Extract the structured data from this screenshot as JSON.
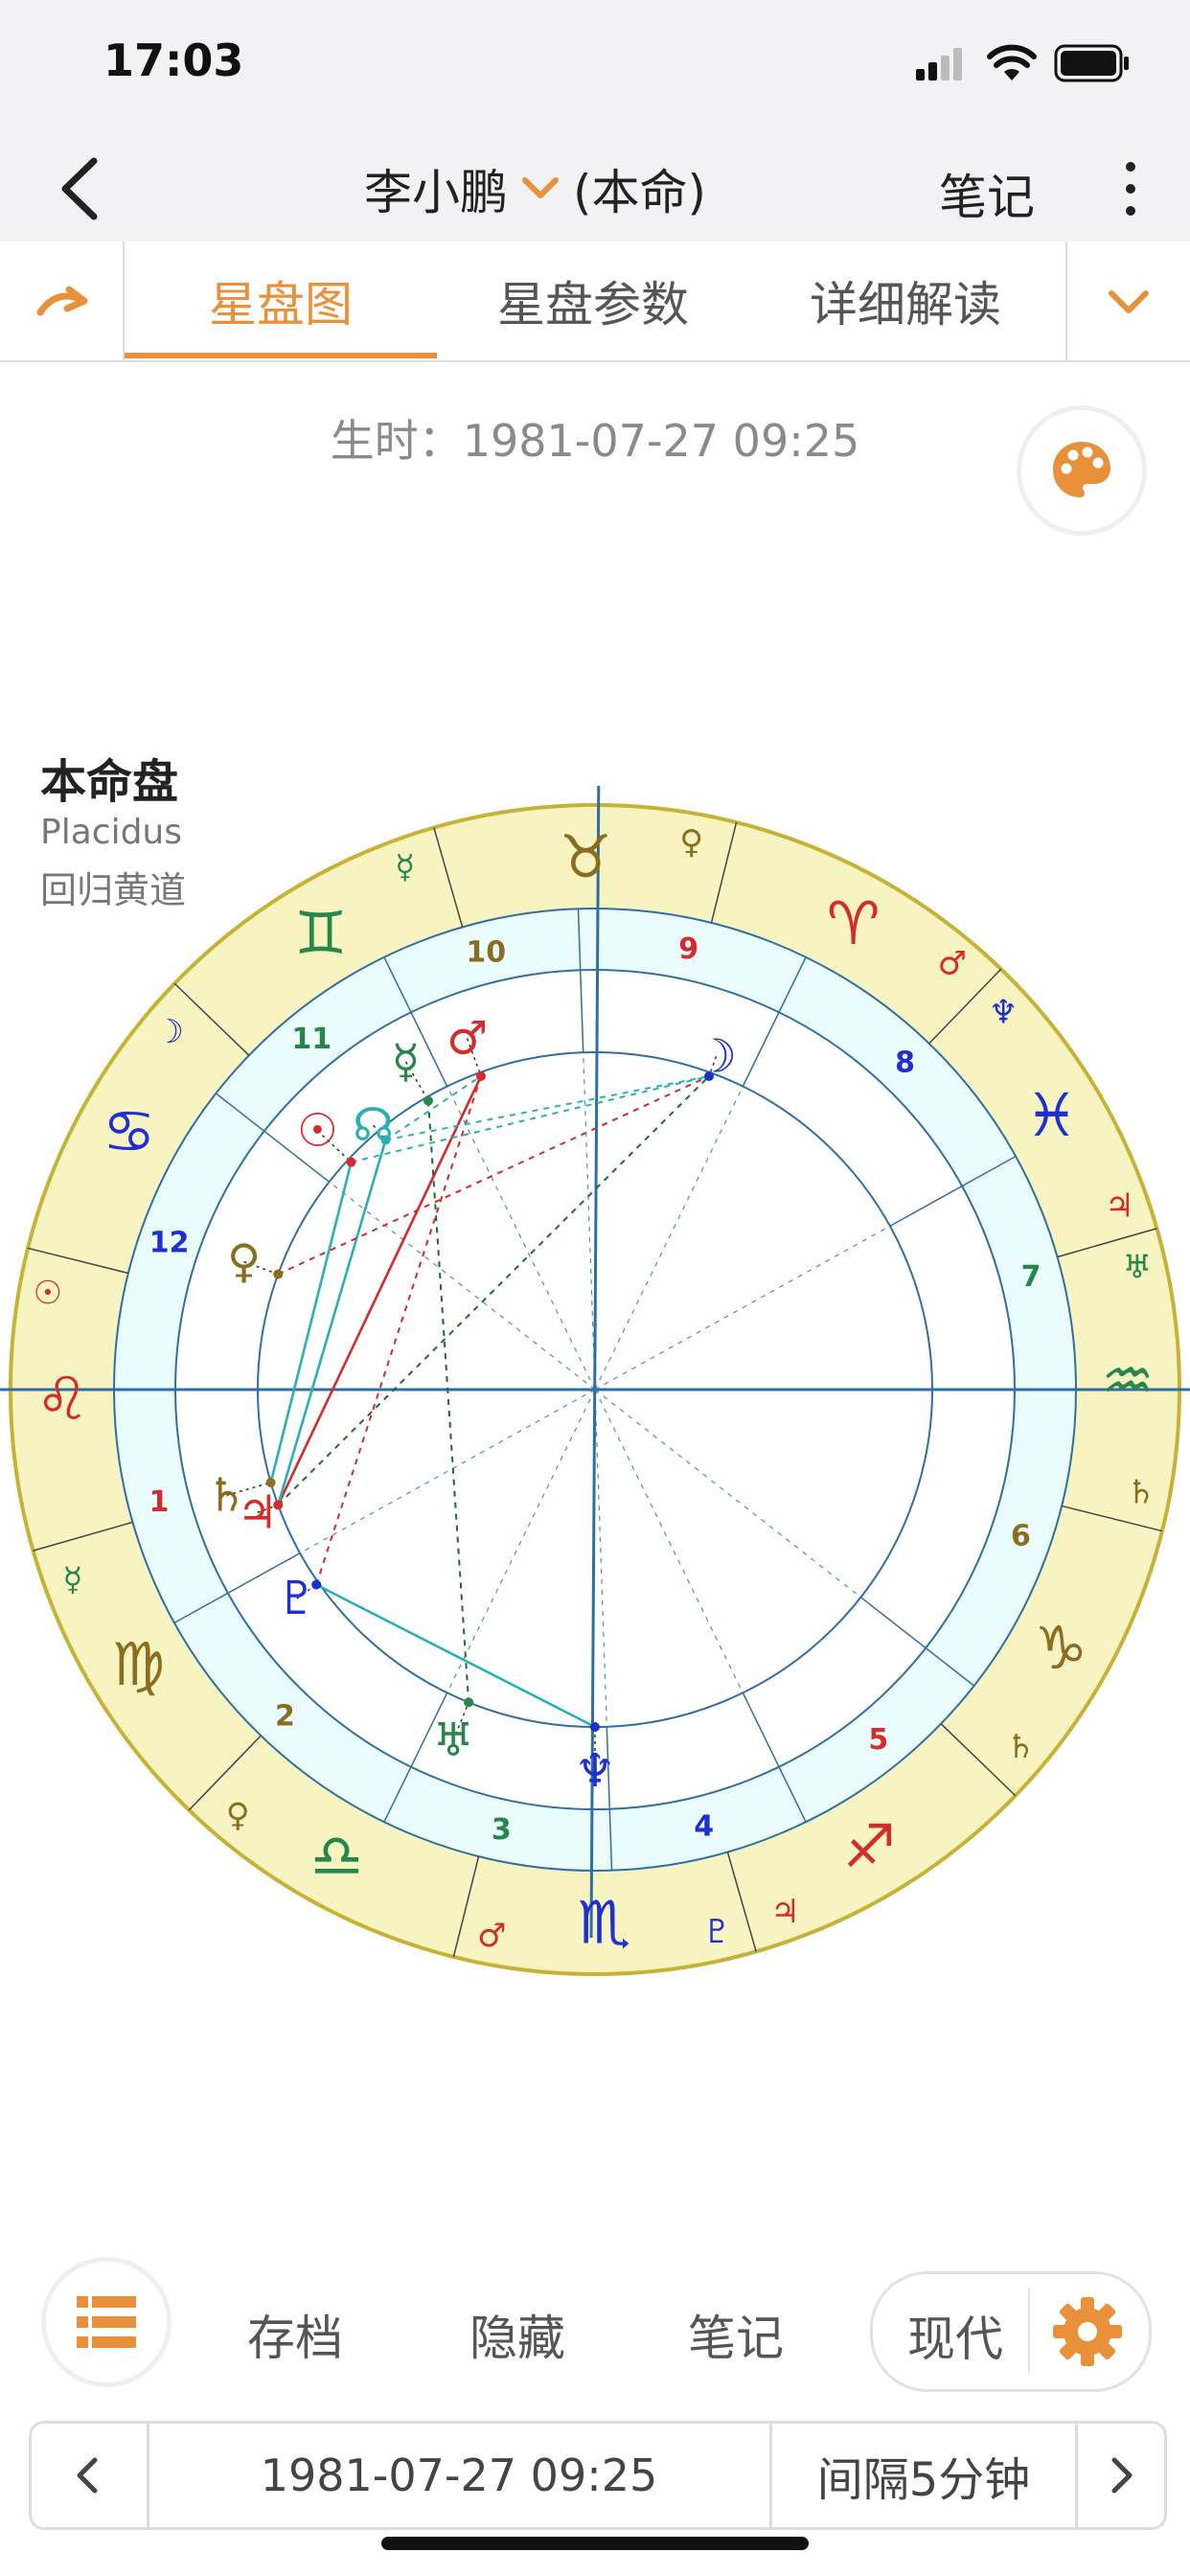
{
  "status_bar": {
    "time": "17:03"
  },
  "nav": {
    "name": "李小鹏",
    "chart_kind": "(本命)",
    "notes": "笔记"
  },
  "tabs": [
    "星盘图",
    "星盘参数",
    "详细解读"
  ],
  "birth": {
    "label": "生时：",
    "datetime": "1981-07-27 09:25"
  },
  "chart": {
    "label": "本命盘",
    "house_system": "Placidus",
    "zodiac_type": "回归黄道",
    "signs": [
      {
        "glyph": "♒",
        "color": "#27874a",
        "rulers": [
          {
            "glyph": "♄",
            "color": "#8b6d1f"
          },
          {
            "glyph": "♅",
            "color": "#27874a"
          }
        ]
      },
      {
        "glyph": "♓",
        "color": "#1f2fd0",
        "rulers": [
          {
            "glyph": "♃",
            "color": "#d52b2b"
          },
          {
            "glyph": "♆",
            "color": "#1f2fd0"
          }
        ]
      },
      {
        "glyph": "♈",
        "color": "#d52b2b",
        "rulers": [
          {
            "glyph": "♂",
            "color": "#d52b2b"
          }
        ]
      },
      {
        "glyph": "♉",
        "color": "#8b6d1f",
        "rulers": [
          {
            "glyph": "♀",
            "color": "#8b6d1f"
          }
        ]
      },
      {
        "glyph": "♊",
        "color": "#27874a",
        "rulers": [
          {
            "glyph": "☿",
            "color": "#27874a"
          }
        ]
      },
      {
        "glyph": "♋",
        "color": "#1f2fd0",
        "rulers": [
          {
            "glyph": "☽",
            "color": "#1f2fd0"
          }
        ]
      },
      {
        "glyph": "♌",
        "color": "#d52b2b",
        "rulers": [
          {
            "glyph": "☉",
            "color": "#d52b2b"
          }
        ]
      },
      {
        "glyph": "♍",
        "color": "#8b6d1f",
        "rulers": [
          {
            "glyph": "☿",
            "color": "#27874a"
          }
        ]
      },
      {
        "glyph": "♎",
        "color": "#27874a",
        "rulers": [
          {
            "glyph": "♀",
            "color": "#8b6d1f"
          }
        ]
      },
      {
        "glyph": "♏",
        "color": "#1f2fd0",
        "rulers": [
          {
            "glyph": "♂",
            "color": "#d52b2b"
          },
          {
            "glyph": "♇",
            "color": "#1f2fd0"
          }
        ]
      },
      {
        "glyph": "♐",
        "color": "#d52b2b",
        "rulers": [
          {
            "glyph": "♃",
            "color": "#d52b2b"
          }
        ]
      },
      {
        "glyph": "♑",
        "color": "#8b6d1f",
        "rulers": [
          {
            "glyph": "♄",
            "color": "#8b6d1f"
          }
        ]
      }
    ],
    "houses": [
      {
        "n": "1",
        "color": "#d52b2b"
      },
      {
        "n": "2",
        "color": "#8b6d1f"
      },
      {
        "n": "3",
        "color": "#27874a"
      },
      {
        "n": "4",
        "color": "#1f2fd0"
      },
      {
        "n": "5",
        "color": "#d52b2b"
      },
      {
        "n": "6",
        "color": "#8b6d1f"
      },
      {
        "n": "7",
        "color": "#27874a"
      },
      {
        "n": "8",
        "color": "#1f2fd0"
      },
      {
        "n": "9",
        "color": "#d52b2b"
      },
      {
        "n": "10",
        "color": "#8b6d1f"
      },
      {
        "n": "11",
        "color": "#27874a"
      },
      {
        "n": "12",
        "color": "#1f2fd0"
      }
    ],
    "planets": [
      {
        "id": "moon",
        "glyph": "☽",
        "color": "#1f2fd0"
      },
      {
        "id": "mars",
        "glyph": "♂",
        "color": "#d52b2b"
      },
      {
        "id": "mercury",
        "glyph": "☿",
        "color": "#27874a"
      },
      {
        "id": "node",
        "glyph": "☊",
        "color": "#2ab0b8"
      },
      {
        "id": "sun",
        "glyph": "☉",
        "color": "#d52b2b"
      },
      {
        "id": "venus",
        "glyph": "♀",
        "color": "#8b6d1f"
      },
      {
        "id": "saturn",
        "glyph": "♄",
        "color": "#8b6d1f"
      },
      {
        "id": "jupiter",
        "glyph": "♃",
        "color": "#d52b2b"
      },
      {
        "id": "pluto",
        "glyph": "♇",
        "color": "#1f2fd0"
      },
      {
        "id": "uranus",
        "glyph": "♅",
        "color": "#27874a"
      },
      {
        "id": "neptune",
        "glyph": "♆",
        "color": "#1f2fd0"
      }
    ],
    "colors": {
      "ring": "#f7f4c2",
      "ring_border": "#c8b236",
      "house_band": "#eafcfd",
      "line": "#2f6ea5"
    }
  },
  "bottom": {
    "archive": "存档",
    "hide": "隐藏",
    "notes": "笔记",
    "mode": "现代"
  },
  "date_bar": {
    "datetime": "1981-07-27 09:25",
    "interval": "间隔5分钟"
  },
  "accent": "#e8913a"
}
